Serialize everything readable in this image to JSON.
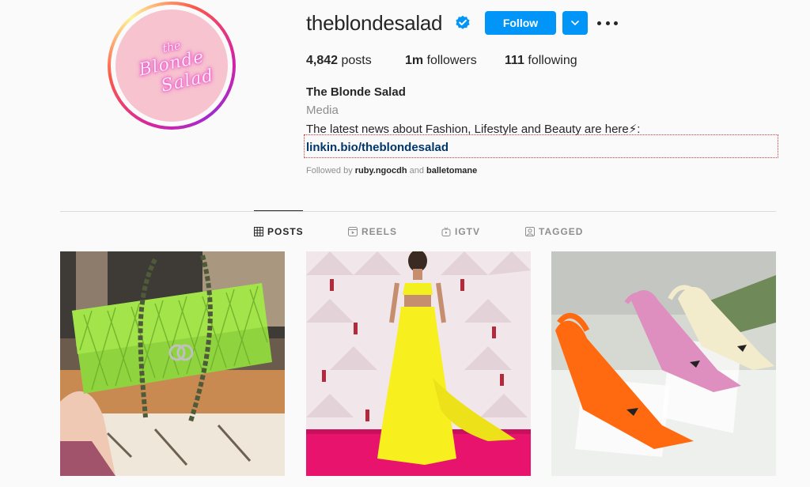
{
  "profile": {
    "username": "theblondesalad",
    "verified": true,
    "follow_label": "Follow",
    "avatar_logo": [
      "the",
      "Blonde",
      "Salad"
    ],
    "stats": {
      "posts_count": "4,842",
      "posts_label": " posts",
      "followers_count": "1m",
      "followers_label": " followers",
      "following_count": "111",
      "following_label": " following"
    },
    "full_name": "The Blonde Salad",
    "category": "Media",
    "bio": "The latest news about Fashion, Lifestyle and Beauty are here⚡:",
    "link": "linkin.bio/theblondesalad",
    "followed_by_prefix": "Followed by ",
    "followed_by_user1": "ruby.ngocdh",
    "followed_by_and": " and ",
    "followed_by_user2": "balletomane"
  },
  "tabs": [
    {
      "label": "POSTS",
      "icon": "grid-icon",
      "active": true
    },
    {
      "label": "REELS",
      "icon": "reels-icon",
      "active": false
    },
    {
      "label": "IGTV",
      "icon": "igtv-icon",
      "active": false
    },
    {
      "label": "TAGGED",
      "icon": "tagged-icon",
      "active": false
    }
  ],
  "posts": [
    {
      "description": "green quilted chain handbag"
    },
    {
      "description": "yellow gown on red carpet"
    },
    {
      "description": "slingback heels orange pink cream"
    }
  ],
  "colors": {
    "accent": "#0095f6",
    "link": "#00376b",
    "text": "#262626",
    "muted": "#8e8e8e",
    "background": "#fafafa"
  }
}
